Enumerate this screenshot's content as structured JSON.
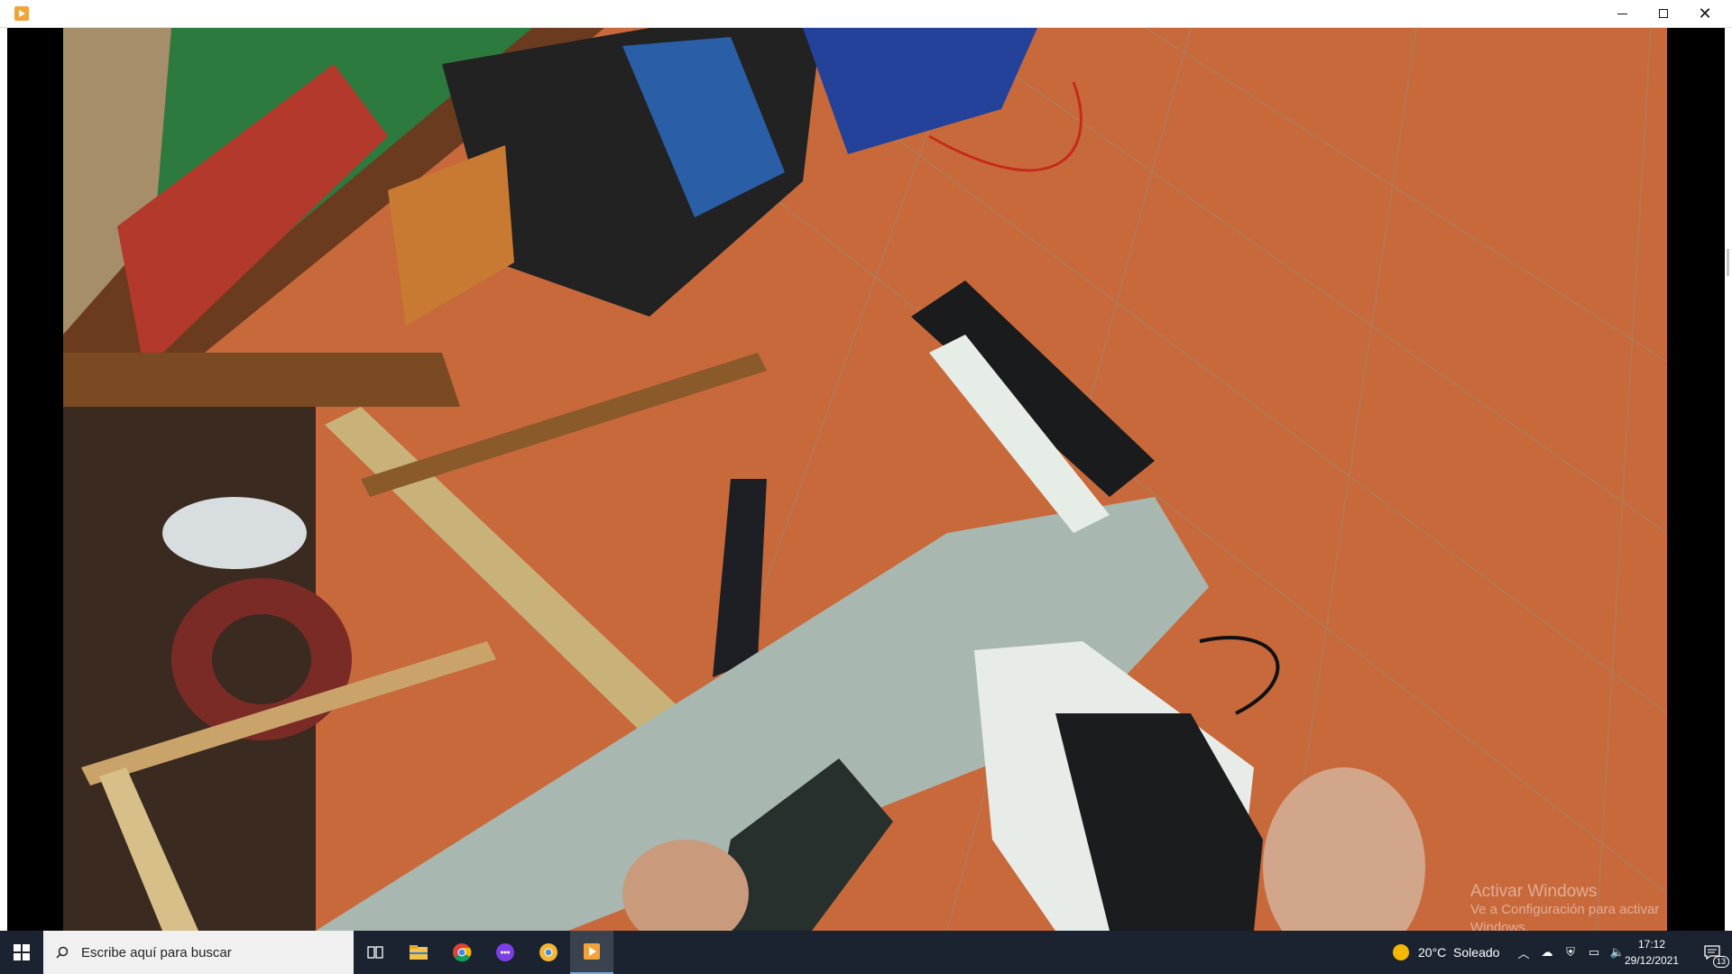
{
  "window": {
    "app_icon": "media-player-icon",
    "controls": {
      "minimize": "minimize-icon",
      "maximize": "maximize-icon",
      "close": "close-icon"
    }
  },
  "video": {
    "content": "video-frame",
    "watermark_line1": "Activar Windows",
    "watermark_line2": "Ve a Configuración para activar Windows."
  },
  "taskbar": {
    "start_icon": "windows-start-icon",
    "search_placeholder": "Escribe aquí para buscar",
    "pinned": [
      "task-view-icon",
      "file-explorer-icon",
      "chrome-icon",
      "messenger-icon",
      "chrome-canary-icon",
      "media-player-icon"
    ],
    "weather_text": "20°C  Soleado",
    "time": "17:12",
    "date": "29/12/2021",
    "notifications_count": "13"
  }
}
